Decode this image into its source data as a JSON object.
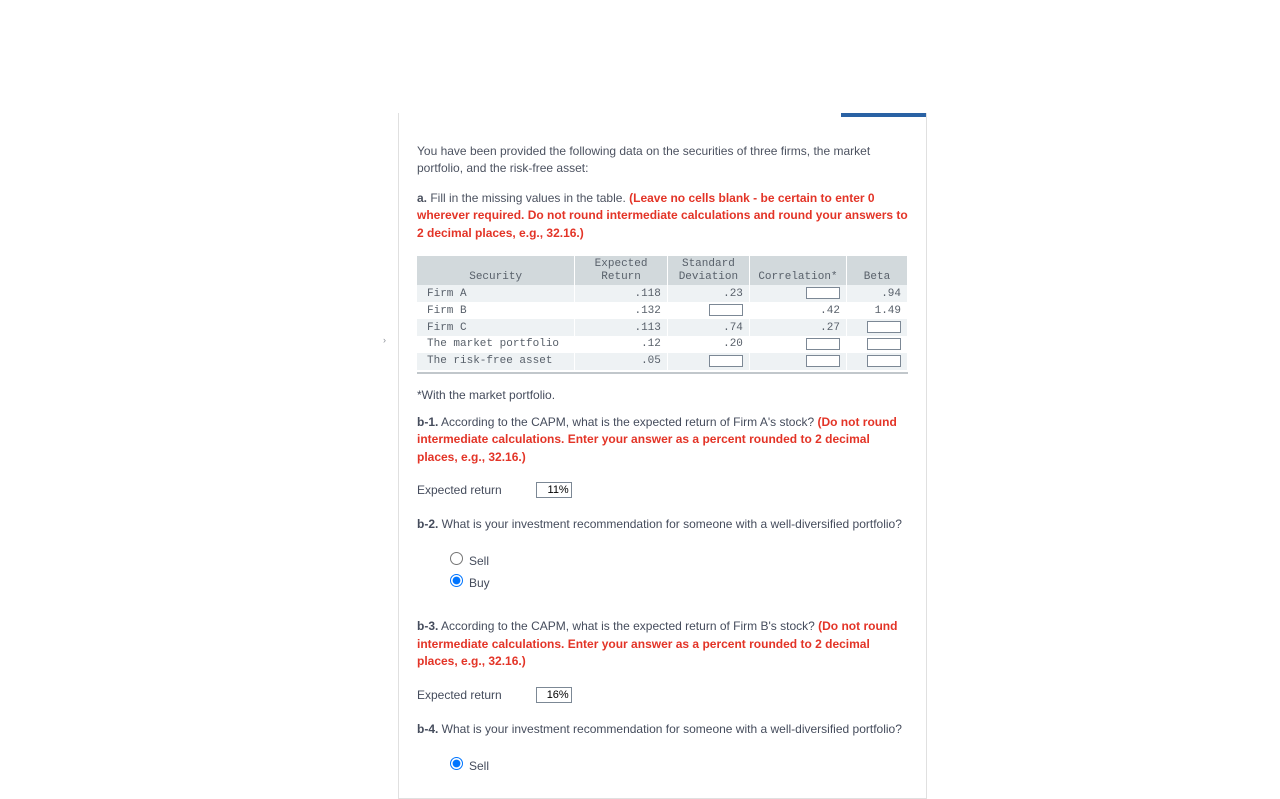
{
  "intro": "You have been provided the following data on the securities of three firms, the market portfolio, and the risk-free asset:",
  "partA": {
    "label": "a.",
    "text": " Fill in the missing values in the table. ",
    "warning": "(Leave no cells blank - be certain to enter 0 wherever required. Do not round intermediate calculations and round your answers to 2 decimal places, e.g., 32.16.)"
  },
  "table": {
    "headers": [
      "Security",
      "Expected Return",
      "Standard Deviation",
      "Correlation*",
      "Beta"
    ],
    "rows": [
      {
        "name": "Firm A",
        "er": ".118",
        "sd": ".23",
        "corr": "",
        "beta": ".94",
        "inputs": {
          "corr": true
        }
      },
      {
        "name": "Firm B",
        "er": ".132",
        "sd": "",
        "corr": ".42",
        "beta": "1.49",
        "inputs": {
          "sd": true
        }
      },
      {
        "name": "Firm C",
        "er": ".113",
        "sd": ".74",
        "corr": ".27",
        "beta": "",
        "inputs": {
          "beta": true
        }
      },
      {
        "name": "The market portfolio",
        "er": ".12",
        "sd": ".20",
        "corr": "",
        "beta": "",
        "inputs": {
          "corr": true,
          "beta": true
        }
      },
      {
        "name": "The risk-free asset",
        "er": ".05",
        "sd": "",
        "corr": "",
        "beta": "",
        "inputs": {
          "sd": true,
          "corr": true,
          "beta": true
        }
      }
    ]
  },
  "footnote": "*With the market portfolio.",
  "b1": {
    "label": "b-1.",
    "text": " According to the CAPM, what is the expected return of Firm A's stock? ",
    "warning": "(Do not round intermediate calculations. Enter your answer as a percent rounded to 2 decimal places, e.g., 32.16.)"
  },
  "ansLabel": "Expected return",
  "b1Value": "11%",
  "b2": {
    "label": "b-2.",
    "text": " What is your investment recommendation for someone with a well-diversified portfolio?"
  },
  "options": {
    "sell": "Sell",
    "buy": "Buy"
  },
  "b3": {
    "label": "b-3.",
    "text": " According to the CAPM, what is the expected return of Firm B's stock? ",
    "warning": "(Do not round intermediate calculations. Enter your answer as a percent rounded to 2 decimal places, e.g., 32.16.)"
  },
  "b3Value": "16%",
  "b4": {
    "label": "b-4.",
    "text": " What is your investment recommendation for someone with a well-diversified portfolio?"
  }
}
